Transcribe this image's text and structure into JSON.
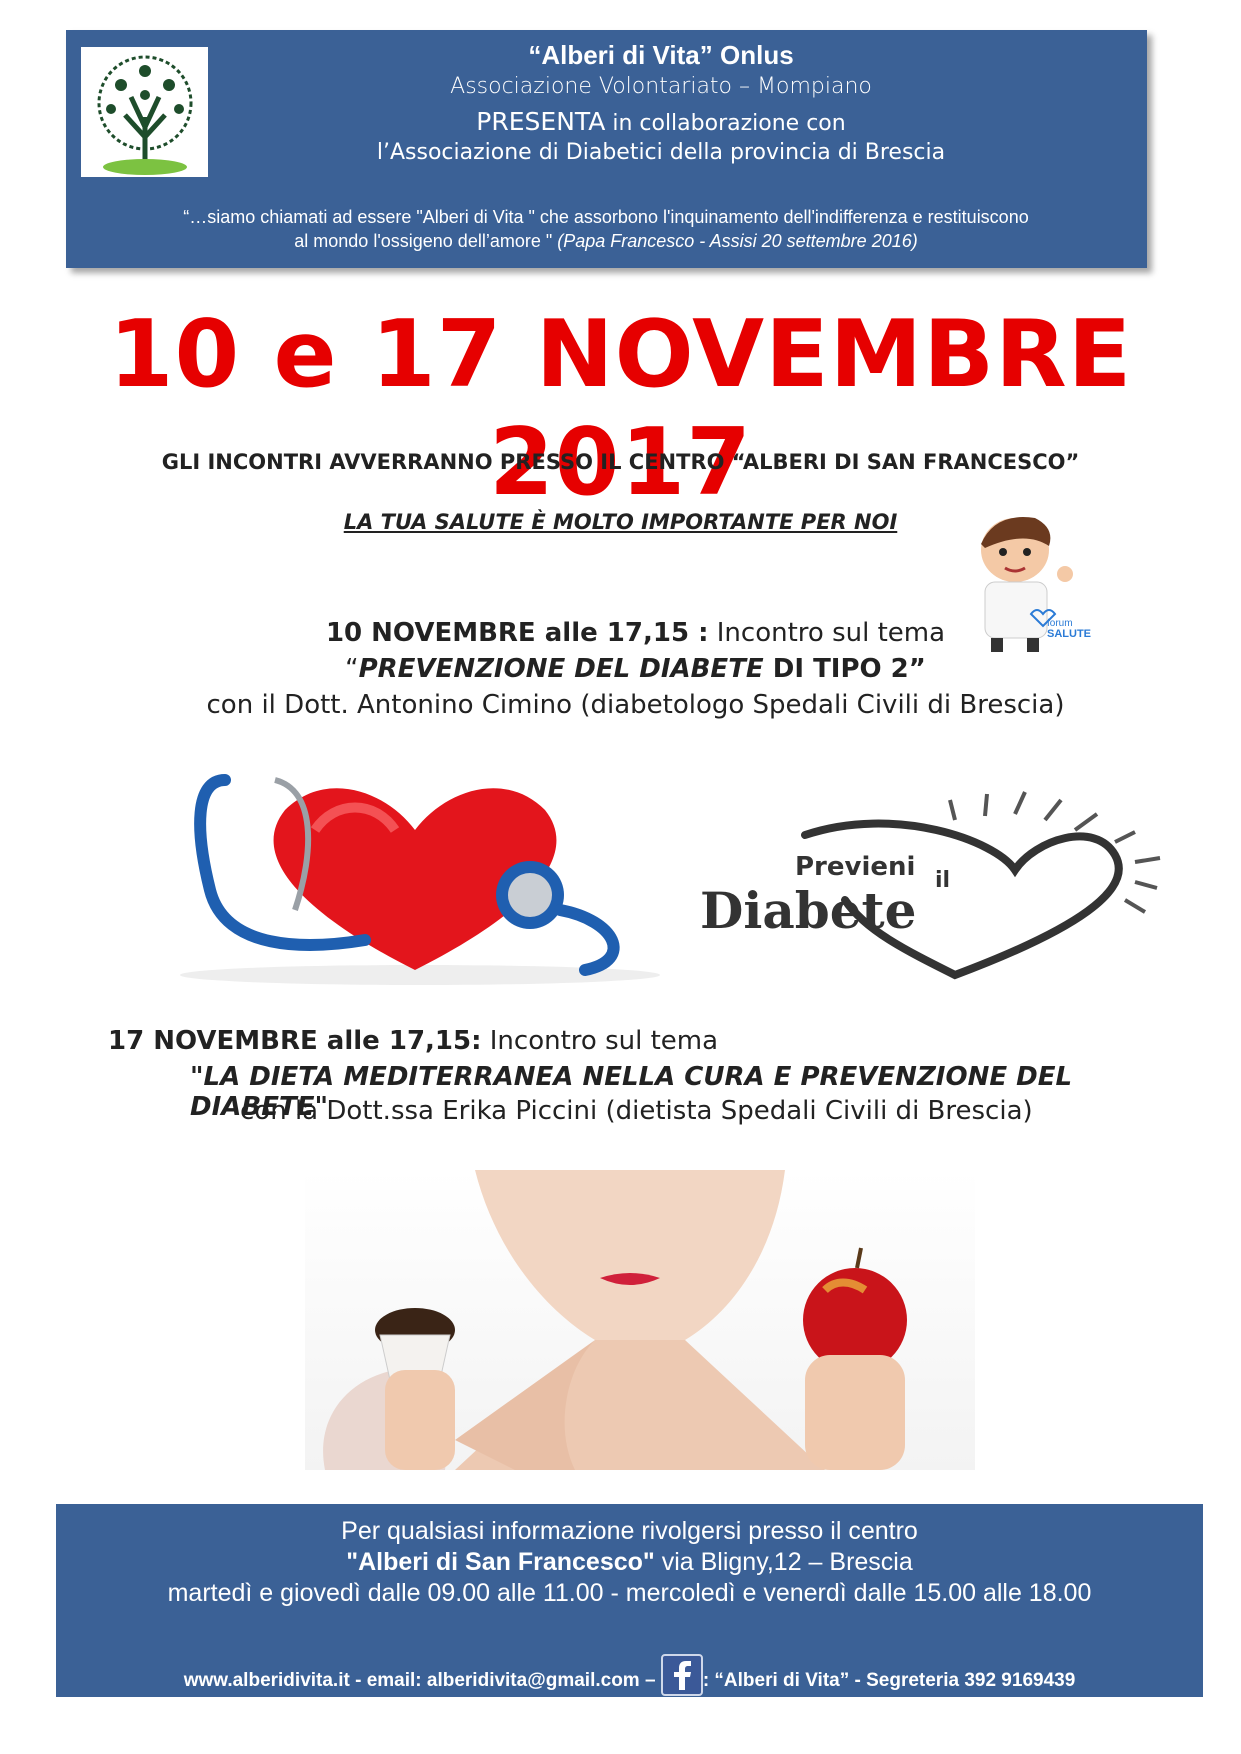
{
  "header": {
    "org_name": "“Alberi di Vita” Onlus",
    "association": "Associazione Volontariato – Mompiano",
    "presents_word": "PRESENTA",
    "presents_rest": " in collaborazione con",
    "partner": "l’Associazione di Diabetici della provincia di Brescia",
    "quote_line1": "“…siamo chiamati ad essere \"Alberi di Vita \" che assorbono l'inquinamento dell'indifferenza e restituiscono",
    "quote_line2": "al mondo l'ossigeno dell’amore \" ",
    "quote_source": "(Papa Francesco - Assisi 20 settembre 2016)"
  },
  "dates_title": "10 e 17 NOVEMBRE 2017",
  "venue": "GLI INCONTRI AVVERRANNO PRESSO IL CENTRO “ALBERI DI SAN FRANCESCO”",
  "slogan": "LA TUA SALUTE È MOLTO IMPORTANTE PER NOI",
  "forum_badge": {
    "line1": "forum",
    "line2": "SALUTE"
  },
  "event1": {
    "when": "10 NOVEMBRE alle 17,15 :",
    "intro": " Incontro sul tema",
    "title_open": "“",
    "title_italic": "PREVENZIONE DEL DIABETE",
    "title_rest": " DI TIPO 2”",
    "speaker": "con il Dott. Antonino Cimino (diabetologo Spedali Civili di Brescia)"
  },
  "prevent_logo": {
    "word1": "Previeni",
    "word2": "il",
    "word3": "Diabete"
  },
  "event2": {
    "when": "17 NOVEMBRE alle 17,15:",
    "intro": " Incontro sul tema",
    "title_italic": "\"LA DIETA MEDITERRANEA NELLA CURA E PREVENZIONE DEL DIABETE",
    "title_close": "\"",
    "speaker": "con la Dott.ssa Erika Piccini (dietista Spedali Civili di Brescia)"
  },
  "footer": {
    "line1": "Per qualsiasi informazione rivolgersi presso il centro",
    "line2_bold": "\"Alberi di San Francesco\"",
    "line2_rest": " via Bligny,12 – Brescia",
    "line3": "martedì e giovedì dalle 09.00 alle 11.00 - mercoledì e venerdì dalle 15.00 alle 18.00",
    "contacts_left": "www.alberidivita.it - email: alberidivita@gmail.com  –  ",
    "contacts_right": ": “Alberi di Vita”  - Segreteria 392 9169439"
  },
  "colors": {
    "header_bg": "#3b6196",
    "title_red": "#e60000",
    "heart_red": "#e3151c",
    "stethoscope_blue": "#1f5fb0"
  }
}
